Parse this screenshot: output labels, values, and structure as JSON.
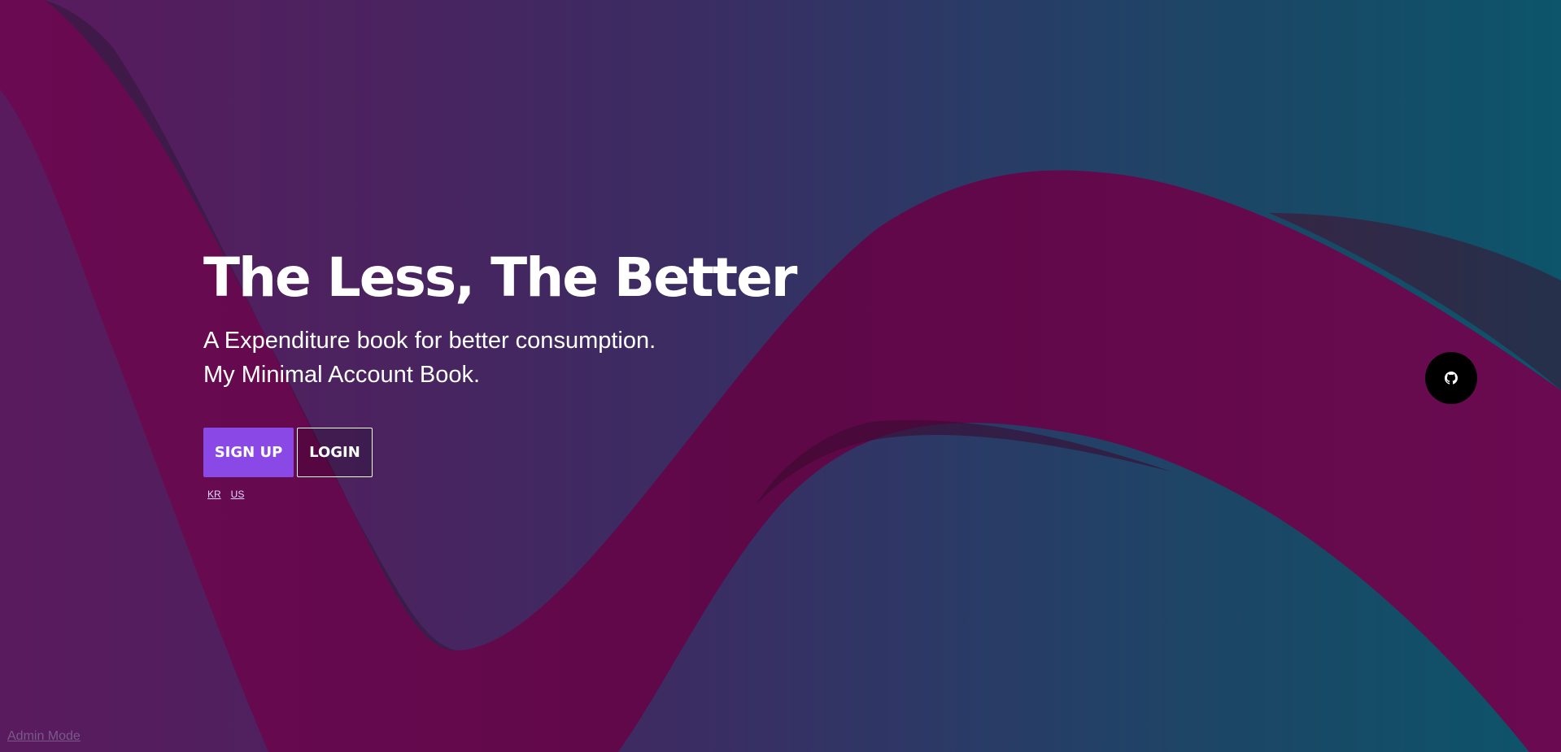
{
  "hero": {
    "title": "The Less, The Better",
    "subtitle_line1": "A Expenditure book for better consumption.",
    "subtitle_line2": "My Minimal Account Book."
  },
  "actions": {
    "signup_label": "SIGN UP",
    "login_label": "LOGIN"
  },
  "languages": [
    "KR",
    "US"
  ],
  "footer": {
    "admin_label": "Admin Mode"
  },
  "icons": {
    "github": "github-icon"
  },
  "colors": {
    "accent": "#8a49e6",
    "ribbon": "#6b0a4f",
    "bg_left": "#5a1a5e",
    "bg_right": "#0c556b"
  }
}
